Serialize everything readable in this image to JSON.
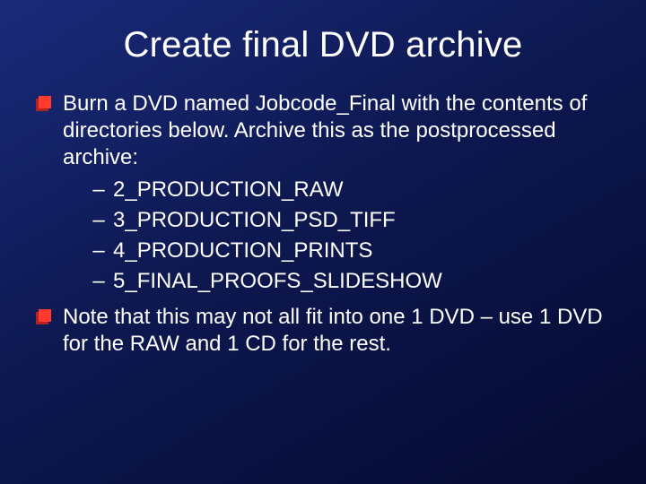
{
  "title": "Create final DVD archive",
  "bullets": {
    "b1": "Burn a DVD named Jobcode_Final with the contents of directories below.  Archive this as the postprocessed archive:",
    "b2": "Note that this may not all fit into one 1 DVD – use 1 DVD for the RAW and 1 CD for the rest."
  },
  "sub": {
    "s1": "2_PRODUCTION_RAW",
    "s2": "3_PRODUCTION_PSD_TIFF",
    "s3": "4_PRODUCTION_PRINTS",
    "s4": "5_FINAL_PROOFS_SLIDESHOW"
  },
  "dash": "–"
}
